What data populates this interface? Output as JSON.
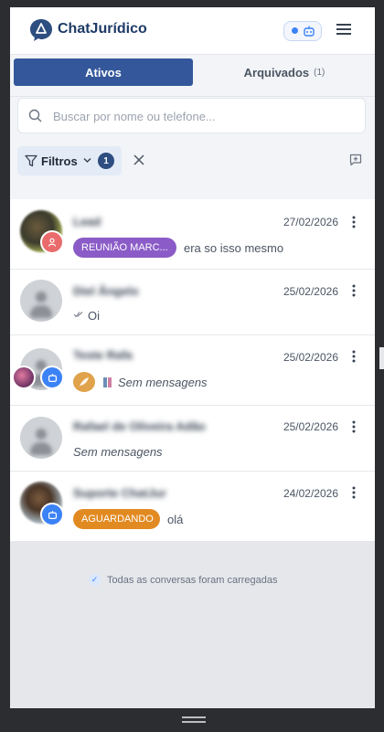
{
  "app": {
    "name": "ChatJurídico"
  },
  "tabs": {
    "active": {
      "label": "Ativos"
    },
    "archived": {
      "label": "Arquivados",
      "count": "(1)"
    }
  },
  "search": {
    "placeholder": "Buscar por nome ou telefone..."
  },
  "filters": {
    "label": "Filtros",
    "count": "1"
  },
  "conversations": [
    {
      "name": "Lead",
      "date": "27/02/2026",
      "tag": "REUNIÃO MARC...",
      "tag_color": "#8b5cc7",
      "preview": "era so isso mesmo",
      "avatar": "photo",
      "badge": "user-icon"
    },
    {
      "name": "Diel Ângelo",
      "date": "25/02/2026",
      "preview": "Oi",
      "status": "read-checkmarks"
    },
    {
      "name": "Teste Rafa",
      "date": "25/02/2026",
      "preview": "Sem mensagens",
      "badge": "bot-icon"
    },
    {
      "name": "Rafael de Oliveira Adão",
      "date": "25/02/2026",
      "preview": "Sem mensagens"
    },
    {
      "name": "Suporte ChatJur",
      "date": "24/02/2026",
      "tag": "AGUARDANDO",
      "tag_color": "#e28a22",
      "preview": "olá",
      "avatar": "photo",
      "badge": "bot-icon"
    }
  ],
  "footer": {
    "note": "Todas as conversas foram carregadas"
  }
}
